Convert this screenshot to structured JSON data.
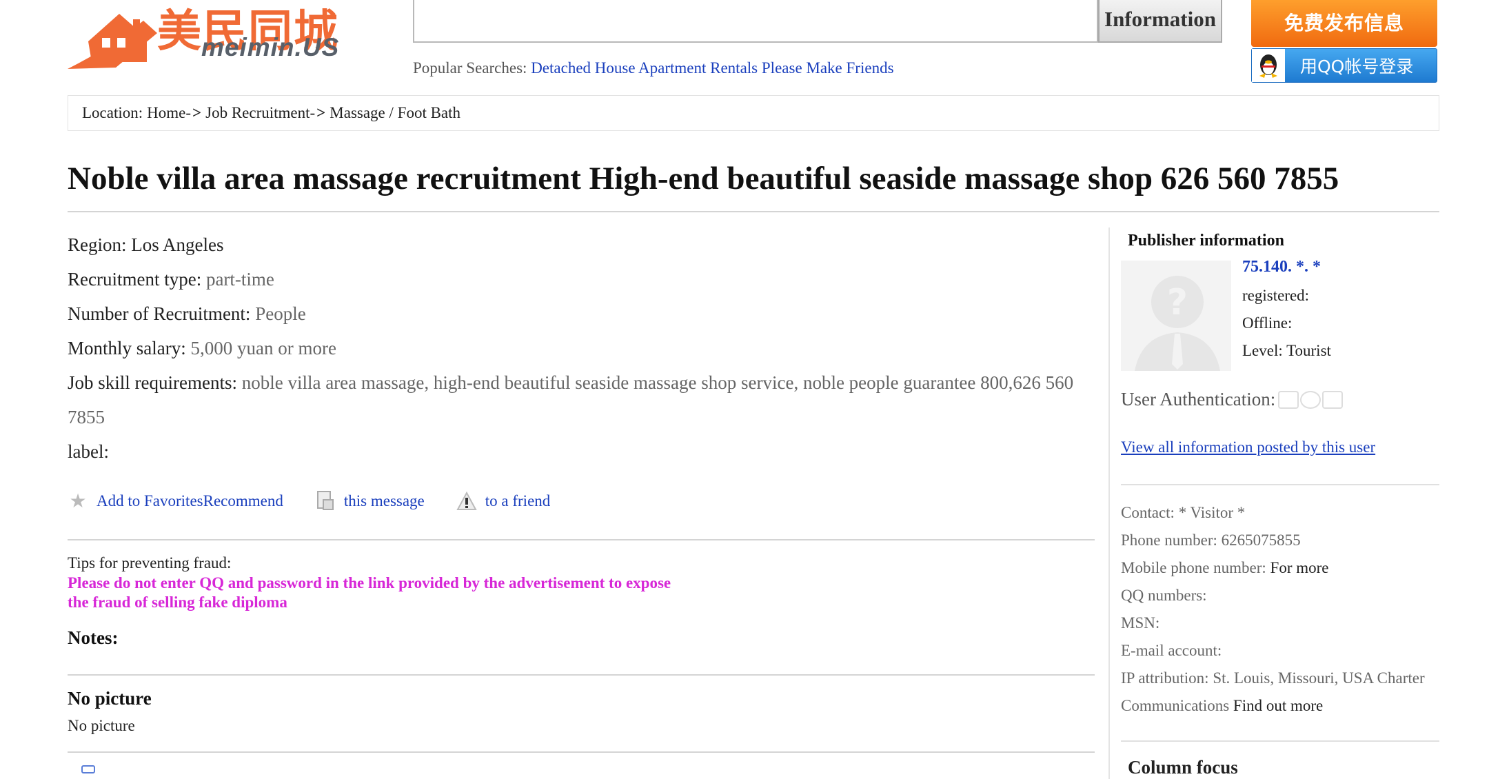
{
  "logo": {
    "chinese": "美民同城",
    "domain": "meimin.US"
  },
  "search": {
    "value": "",
    "button": "Information"
  },
  "popular": {
    "label": "Popular Searches:",
    "links": [
      "Detached House",
      "Apartment Rentals",
      "Please Make Friends"
    ]
  },
  "header_buttons": {
    "post": "免费发布信息",
    "qq_login": "用QQ帐号登录"
  },
  "breadcrumb": {
    "label": "Location:",
    "items": [
      "Home-",
      "Job Recruitment-",
      "Massage / Foot Bath"
    ],
    "separator": ">"
  },
  "title": "Noble villa area massage recruitment High-end beautiful seaside massage shop 626 560 7855",
  "details": {
    "region_label": "Region:",
    "region": "Los Angeles",
    "type_label": "Recruitment type:",
    "type": "part-time",
    "number_label": "Number of Recruitment:",
    "number": "People",
    "salary_label": "Monthly salary:",
    "salary": "5,000 yuan or more",
    "skills_label": "Job skill requirements:",
    "skills": "noble villa area massage, high-end beautiful seaside massage shop service, noble people guarantee 800,626 560 7855",
    "tag_label": "label:"
  },
  "actions": {
    "favorites": "Add to FavoritesRecommend",
    "message": "this message",
    "friend": "to a friend"
  },
  "tips": {
    "heading": "Tips for preventing fraud:",
    "body": "Please do not enter QQ and password in the link provided by the advertisement to expose the fraud of selling fake diploma"
  },
  "notes": "Notes:",
  "nopicture": {
    "heading": "No picture",
    "text": "No picture"
  },
  "publisher": {
    "heading": "Publisher information",
    "ip": "75.140. *. *",
    "registered": "registered:",
    "offline": "Offline:",
    "level": "Level: Tourist",
    "auth_label": "User Authentication:",
    "view_all": "View all information posted by this user"
  },
  "contact": {
    "contact_label": "Contact:",
    "contact": "* Visitor *",
    "phone_label": "Phone number:",
    "phone": "6265075855",
    "mobile_label": "Mobile phone number:",
    "mobile": "For more",
    "qq_label": "QQ numbers:",
    "msn_label": "MSN:",
    "email_label": "E-mail account:",
    "ip_label": "IP attribution:",
    "ip_value": "St. Louis, Missouri, USA Charter",
    "ip_value2": "Communications",
    "find_more": "Find out more"
  },
  "column_focus": "Column focus",
  "colors": {
    "link": "#1a3fbd",
    "warning": "#d727d7",
    "orange": "#f06a10",
    "qq_blue": "#1e7ad0"
  }
}
